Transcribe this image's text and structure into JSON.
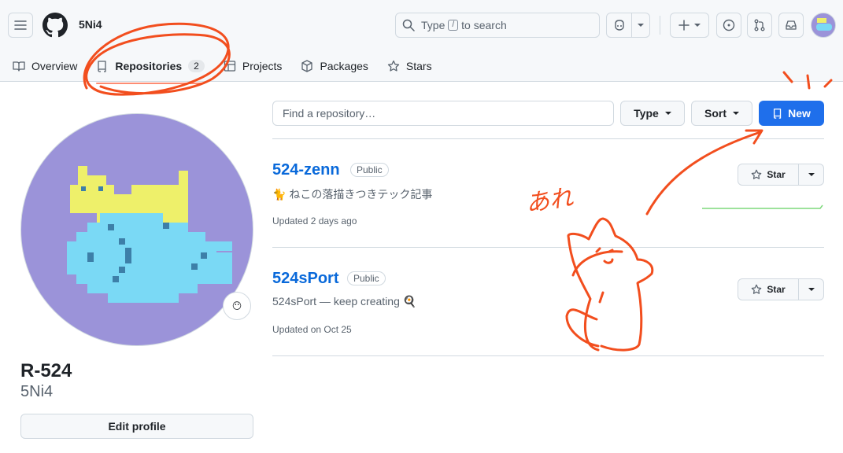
{
  "header": {
    "username": "5Ni4",
    "search": {
      "prefix": "Type",
      "key": "/",
      "suffix": "to search"
    }
  },
  "tabs": [
    {
      "label": "Overview",
      "icon": "book-icon"
    },
    {
      "label": "Repositories",
      "count": "2",
      "icon": "repo-icon",
      "active": true
    },
    {
      "label": "Projects",
      "icon": "table-icon"
    },
    {
      "label": "Packages",
      "icon": "package-icon"
    },
    {
      "label": "Stars",
      "icon": "star-icon"
    }
  ],
  "profile": {
    "full_name": "R-524",
    "login": "5Ni4",
    "edit_label": "Edit profile",
    "status_emoji": "😶"
  },
  "controls": {
    "find_placeholder": "Find a repository…",
    "type_label": "Type",
    "sort_label": "Sort",
    "new_label": "New"
  },
  "repos": [
    {
      "name": "524-zenn",
      "visibility": "Public",
      "description": "🐈 ねこの落描きつきテック記事",
      "updated": "Updated 2 days ago",
      "star_label": "Star"
    },
    {
      "name": "524sPort",
      "visibility": "Public",
      "description": "524sPort — keep creating 🍳",
      "updated": "Updated on Oct 25",
      "star_label": "Star"
    }
  ],
  "annotation": {
    "handwritten": "あれ"
  },
  "colors": {
    "accent": "#1f6feb",
    "link": "#0969da",
    "annotation": "#f24e1e",
    "avatar_bg": "#9b93d9"
  }
}
